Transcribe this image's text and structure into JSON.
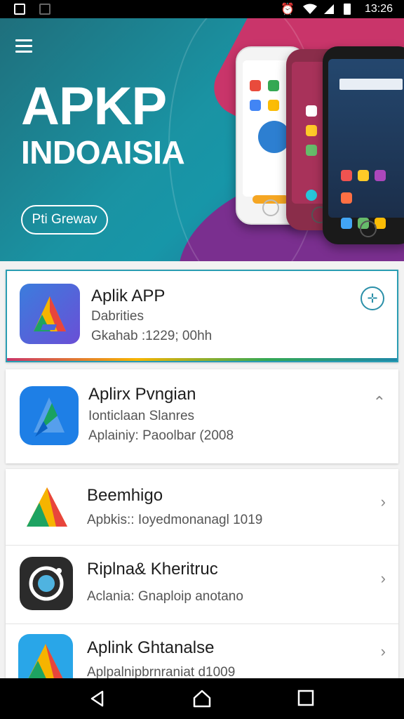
{
  "status_bar": {
    "time": "13:26"
  },
  "hero": {
    "title": "APKP",
    "subtitle": "INDOAISIA",
    "button_label": "Pti Grewav"
  },
  "apps": [
    {
      "title": "Aplik APP",
      "line1": "Dabrities",
      "line2": "Gkahab :1229; 00hh"
    },
    {
      "title": "Aplirx Pvngian",
      "line1": "Ionticlaan Slanres",
      "line2": "Aplainiy: Paoolbar (2008"
    },
    {
      "title": "Beemhigo",
      "line2": "Apbkis:: Ioyedmonanagl 1019"
    },
    {
      "title": "Riplna& Kheritruc",
      "line2": "Aclania: Gnaploip anotano"
    },
    {
      "title": "Aplink Ghtanalse",
      "line2": "Aplpalnipbrnraniat d1009"
    }
  ],
  "colors": {
    "accent": "#1e88a8",
    "hero_bg": "#1a93a3",
    "hero_magenta": "#c9356a",
    "hero_purple": "#7a2f8f"
  }
}
